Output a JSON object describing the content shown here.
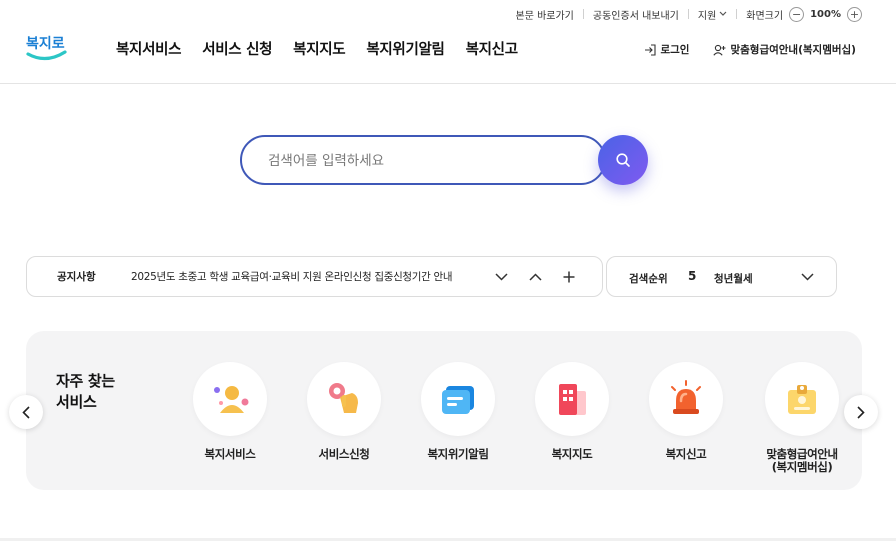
{
  "utility": {
    "skip": "본문 바로가기",
    "cert": "공동인증서 내보내기",
    "support": "지원",
    "zoom_label": "화면크기",
    "zoom_value": "100%"
  },
  "logo": {
    "text": "복지로"
  },
  "nav": [
    "복지서비스",
    "서비스 신청",
    "복지지도",
    "복지위기알림",
    "복지신고"
  ],
  "header_right": {
    "login": "로그인",
    "custom": "맞춤형급여안내(복지멤버십)"
  },
  "search": {
    "placeholder": "검색어를 입력하세요"
  },
  "notice": {
    "label": "공지사항",
    "text": "2025년도 초중고 학생 교육급여·교육비 지원 온라인신청 집중신청기간 안내"
  },
  "rank": {
    "label": "검색순위",
    "number": "5",
    "keyword": "청년월세"
  },
  "quick": {
    "title": "자주 찾는\n서비스",
    "items": [
      {
        "label": "복지서비스",
        "icon": "people-icon"
      },
      {
        "label": "서비스신청",
        "icon": "hand-tap-icon"
      },
      {
        "label": "복지위기알림",
        "icon": "message-icon"
      },
      {
        "label": "복지지도",
        "icon": "map-icon"
      },
      {
        "label": "복지신고",
        "icon": "siren-icon"
      },
      {
        "label": "맞춤형급여안내\n(복지멤버십)",
        "icon": "id-card-icon"
      }
    ]
  },
  "colors": {
    "primary": "#3f58b8",
    "accent": "#7f5af0",
    "logo_blue": "#1a7fd4",
    "logo_teal": "#2cc6c6"
  }
}
